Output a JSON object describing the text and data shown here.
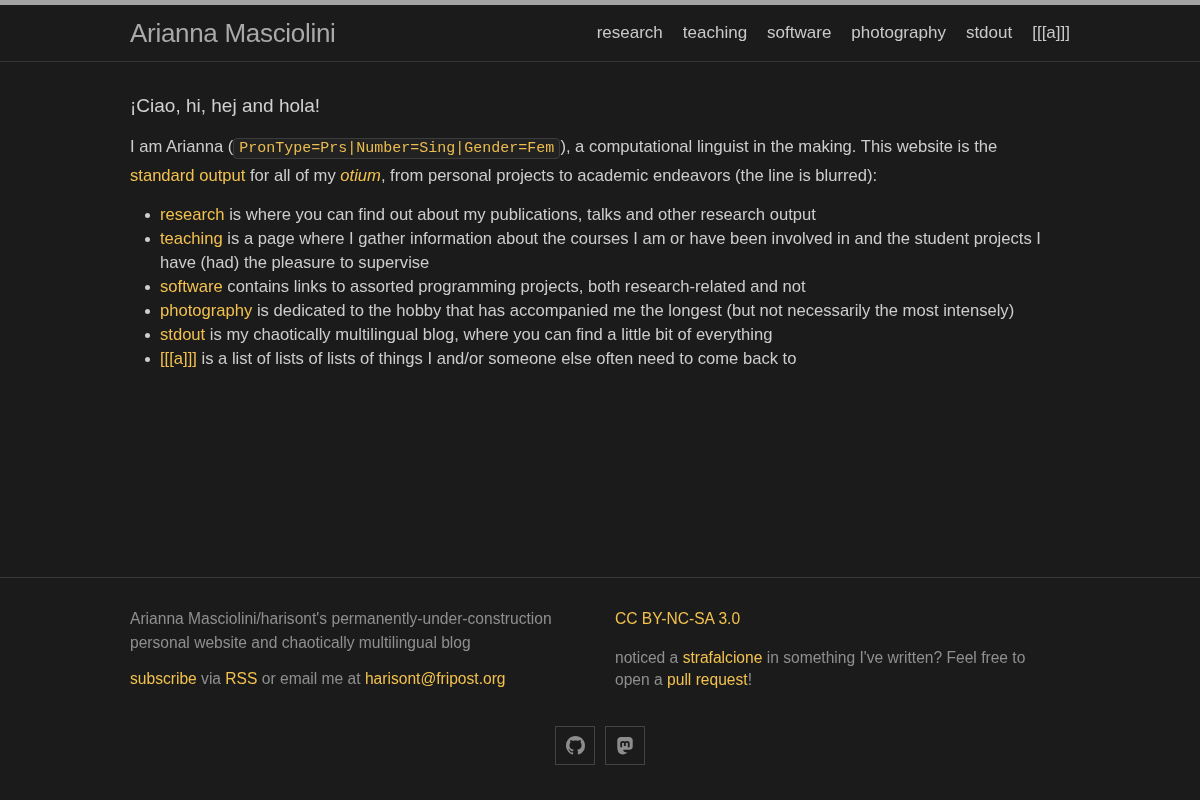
{
  "header": {
    "title": "Arianna Masciolini",
    "nav": [
      {
        "label": "research"
      },
      {
        "label": "teaching"
      },
      {
        "label": "software"
      },
      {
        "label": "photography"
      },
      {
        "label": "stdout"
      },
      {
        "label": "[[[a]]]"
      }
    ]
  },
  "main": {
    "greeting": "¡Ciao, hi, hej and hola!",
    "intro": [
      {
        "kind": "text",
        "text": "I am Arianna ("
      },
      {
        "kind": "code",
        "text": "PronType=Prs|Number=Sing|Gender=Fem"
      },
      {
        "kind": "text",
        "text": "), a computational linguist in the making. This website is the "
      },
      {
        "kind": "link",
        "text": "standard output"
      },
      {
        "kind": "text",
        "text": " for all of my *otium*, from personal projects to academic endeavors (the line is blurred):"
      }
    ],
    "items": [
      {
        "link": "research",
        "text": " is where you can find out about my publications, talks and other research output"
      },
      {
        "link": "teaching",
        "text": " is a page where I gather information about the courses I am or have been involved in and the student projects I have (had) the pleasure to supervise"
      },
      {
        "link": "software",
        "text": " contains links to assorted programming projects, both research-related and not"
      },
      {
        "link": "photography",
        "text": " is dedicated to the hobby that has accompanied me the longest (but not necessarily the most intensely)"
      },
      {
        "link": "stdout",
        "text": " is my chaotically multilingual blog, where you can find a little bit of everything"
      },
      {
        "link": "[[[a]]]",
        "text": " is a list of lists of lists of things I and/or someone else often need to come back to"
      }
    ]
  },
  "footer": {
    "about": "Arianna Masciolini/harisont's permanently-under-construction personal website and chaotically multilingual blog",
    "contact": [
      {
        "kind": "link",
        "text": "subscribe"
      },
      {
        "kind": "text",
        "text": " via "
      },
      {
        "kind": "link",
        "text": "RSS"
      },
      {
        "kind": "text",
        "text": " or email me at "
      },
      {
        "kind": "link",
        "text": "harisont@fripost.org"
      }
    ],
    "license": "CC BY-NC-SA 3.0",
    "feedback": [
      {
        "kind": "text",
        "text": "noticed a "
      },
      {
        "kind": "link",
        "text": "strafalcione"
      },
      {
        "kind": "text",
        "text": " in something I've written? Feel free to open a "
      },
      {
        "kind": "link",
        "text": "pull request"
      },
      {
        "kind": "text",
        "text": "!"
      }
    ],
    "social": [
      {
        "kind": "github"
      },
      {
        "kind": "mastodon"
      }
    ]
  }
}
